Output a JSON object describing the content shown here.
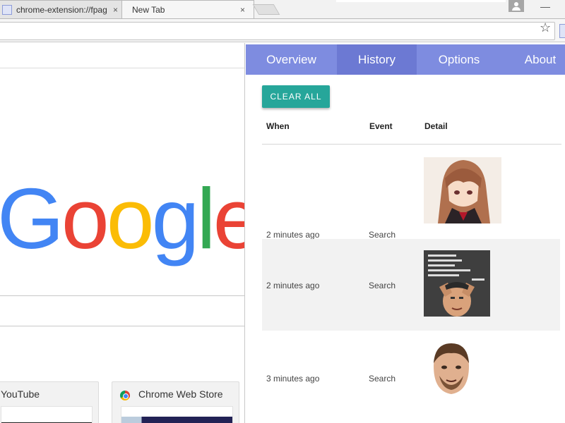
{
  "browser": {
    "tabs": [
      {
        "title": "chrome-extension://fpag",
        "close": "×",
        "active": false
      },
      {
        "title": "New Tab",
        "close": "×",
        "active": true
      }
    ],
    "minimize": "—",
    "star": "☆"
  },
  "new_tab_page": {
    "logo_letters": [
      {
        "char": "G",
        "color": "#4285f4"
      },
      {
        "char": "o",
        "color": "#ea4335"
      },
      {
        "char": "o",
        "color": "#fbbc05"
      },
      {
        "char": "g",
        "color": "#4285f4"
      },
      {
        "char": "l",
        "color": "#34a853"
      },
      {
        "char": "e",
        "color": "#ea4335"
      }
    ],
    "tiles": [
      {
        "title": "YouTube"
      },
      {
        "title": "Chrome Web Store"
      }
    ]
  },
  "extension": {
    "nav": [
      {
        "label": "Overview",
        "active": false
      },
      {
        "label": "History",
        "active": true
      },
      {
        "label": "Options",
        "active": false
      },
      {
        "label": "About",
        "active": false
      }
    ],
    "accent": "#7e8ce0",
    "clear_button": "CLEAR ALL",
    "columns": {
      "when": "When",
      "event": "Event",
      "detail": "Detail"
    },
    "rows": [
      {
        "when": "2 minutes ago",
        "event": "Search",
        "detail_image": "anime-girl-image"
      },
      {
        "when": "2 minutes ago",
        "event": "Search",
        "detail_image": "meme-image"
      },
      {
        "when": "3 minutes ago",
        "event": "Search",
        "detail_image": "face-image"
      }
    ]
  }
}
